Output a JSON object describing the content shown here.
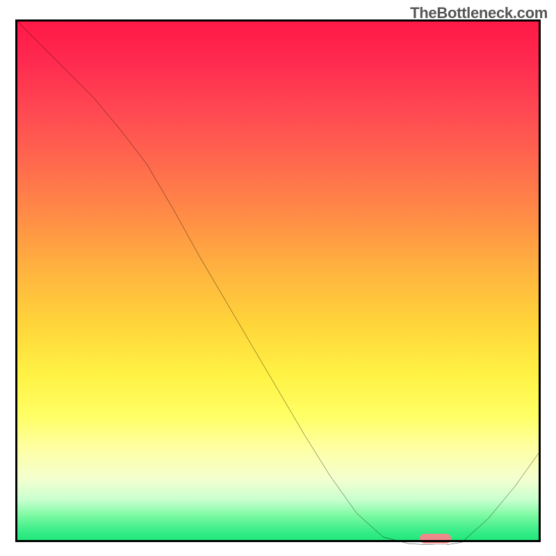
{
  "watermark": "TheBottleneck.com",
  "colors": {
    "pill": "#ef8a8a",
    "curve": "#000000",
    "border": "#000000",
    "gradient_top": "#ff1846",
    "gradient_bottom": "#1de778"
  },
  "chart_data": {
    "type": "line",
    "title": "",
    "xlabel": "",
    "ylabel": "",
    "xlim": [
      0,
      100
    ],
    "ylim": [
      0,
      100
    ],
    "grid": false,
    "legend": false,
    "x": [
      0,
      5,
      10,
      15,
      20,
      25,
      30,
      35,
      40,
      45,
      50,
      55,
      60,
      65,
      70,
      75,
      80,
      82,
      85,
      90,
      95,
      100
    ],
    "values": [
      100,
      95,
      90,
      85,
      79,
      72.5,
      64,
      55,
      46.5,
      38,
      29.5,
      21,
      13,
      6,
      1.5,
      0.2,
      0,
      0,
      0.5,
      5,
      11,
      18
    ],
    "notes": "Values read as percentage height from bottom; curve descends from top-left, has a gentle knee around x≈25, reaches a flat minimum around x≈75-82, then rises toward right edge at ~18%.",
    "marker": {
      "shape": "rounded-rect",
      "x_start": 77,
      "x_end": 83,
      "y": 0.7,
      "color": "#ef8a8a"
    }
  }
}
